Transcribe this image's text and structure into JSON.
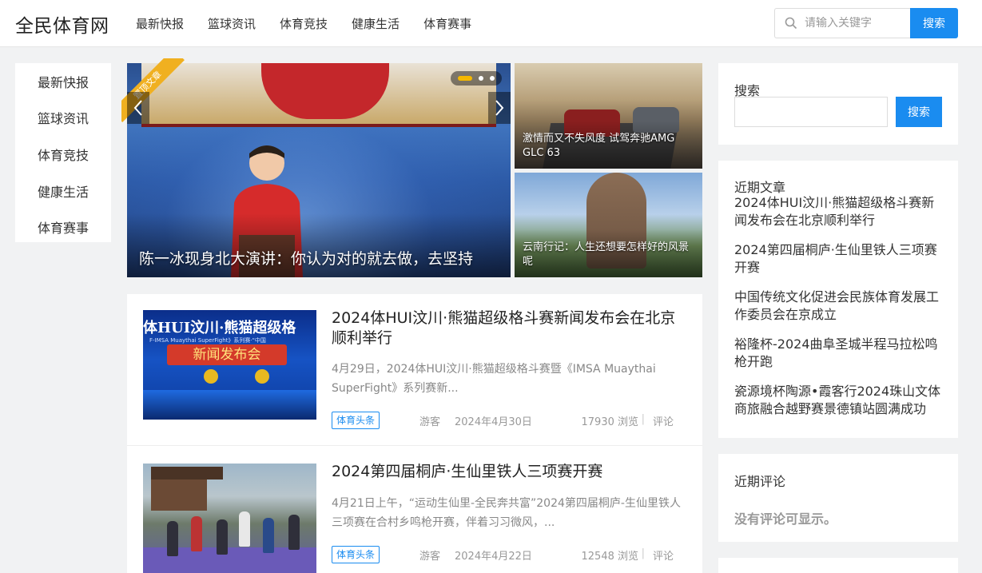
{
  "header": {
    "logo": "全民体育网",
    "nav": [
      "最新快报",
      "篮球资讯",
      "体育竞技",
      "健康生活",
      "体育赛事"
    ],
    "search_placeholder": "请输入关键字",
    "search_button": "搜索"
  },
  "sidebar": {
    "items": [
      "最新快报",
      "篮球资讯",
      "体育竞技",
      "健康生活",
      "体育赛事"
    ]
  },
  "slider": {
    "corner_tag": "置顶文章",
    "caption": "陈一冰现身北大演讲：你认为对的就去做，去坚持",
    "dots_total": 3,
    "active_dot": 1
  },
  "side_features": [
    {
      "caption": "激情而又不失风度 试驾奔驰AMG GLC 63"
    },
    {
      "caption": "云南行记：人生还想要怎样好的风景呢"
    }
  ],
  "thumb_text": {
    "t1_band": "体HUI汶川·熊猫超级格",
    "t1_sub": "F-IMSA Muaythai SuperFight》系列赛·\"中国",
    "t1_red": "新闻发布会"
  },
  "articles": [
    {
      "title": "2024体HUI汶川·熊猫超级格斗赛新闻发布会在北京顺利举行",
      "excerpt": "4月29日，2024体HUI汶川·熊猫超级格斗赛暨《IMSA Muaythai SuperFight》系列赛新...",
      "tag": "体育头条",
      "author": "游客",
      "date": "2024年4月30日",
      "views": "17930 浏览",
      "comment": "评论"
    },
    {
      "title": "2024第四届桐庐·生仙里铁人三项赛开赛",
      "excerpt": "4月21日上午，“运动生仙里-全民奔共富”2024第四届桐庐-生仙里铁人三项赛在合村乡鸣枪开赛，伴着习习微风，...",
      "tag": "体育头条",
      "author": "游客",
      "date": "2024年4月22日",
      "views": "12548 浏览",
      "comment": "评论"
    }
  ],
  "widgets": {
    "search": {
      "title": "搜索",
      "button": "搜索"
    },
    "recent": {
      "title": "近期文章",
      "items": [
        "2024体HUI汶川·熊猫超级格斗赛新闻发布会在北京顺利举行",
        "2024第四届桐庐·生仙里铁人三项赛开赛",
        "中国传统文化促进会民族体育发展工作委员会在京成立",
        "裕隆杯-2024曲阜圣城半程马拉松鸣枪开跑",
        "瓷源境杯陶源•霞客行2024珠山文体商旅融合越野赛景德镇站圆满成功"
      ]
    },
    "comments": {
      "title": "近期评论",
      "empty": "没有评论可显示。"
    }
  },
  "colors": {
    "accent": "#1a8cf0",
    "tag_gold": "#f0b020"
  }
}
